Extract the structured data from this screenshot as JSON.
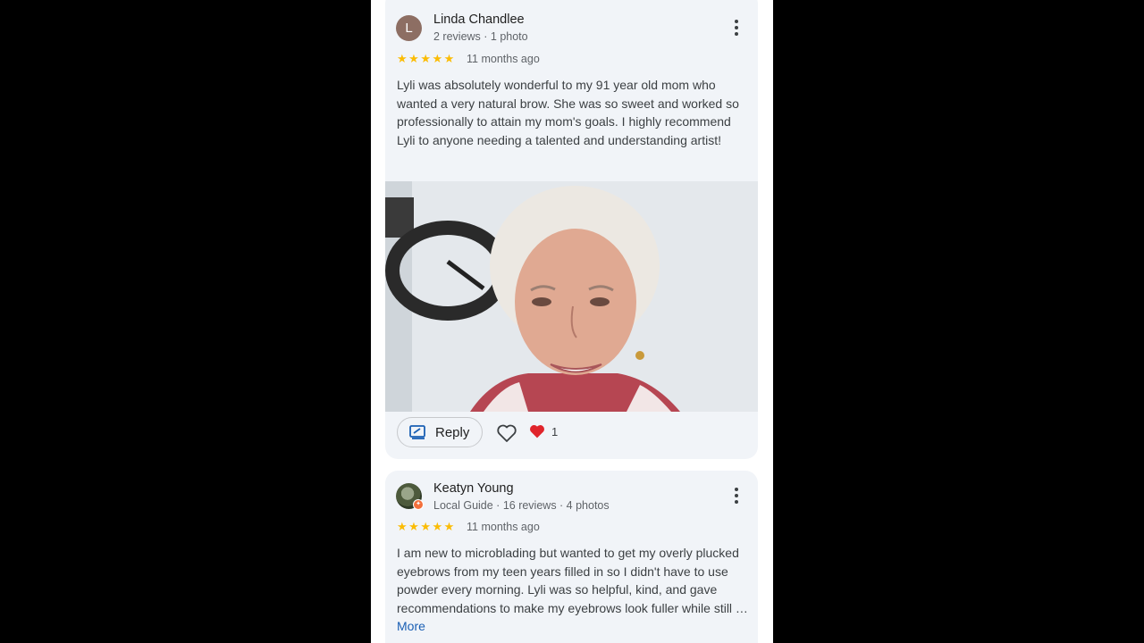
{
  "reviews": [
    {
      "avatar_letter": "L",
      "name": "Linda Chandlee",
      "meta": "2 reviews · 1 photo",
      "rating": 5,
      "when": "11 months ago",
      "text": "Lyli was absolutely wonderful to my 91 year old mom who wanted a very natural brow. She was so sweet and worked so professionally to attain my mom's goals. I highly recommend Lyli to anyone needing a talented and understanding artist!",
      "reply_label": "Reply",
      "reaction_count": "1"
    },
    {
      "name": "Keatyn Young",
      "meta": "Local Guide · 16 reviews · 4 photos",
      "rating": 5,
      "when": "11 months ago",
      "text": "I am new to microblading but wanted to get my overly plucked eyebrows from my teen years filled in so I didn't have to use powder every morning. Lyli was so helpful, kind, and gave recommendations to make my eyebrows look fuller while still …",
      "more_label": "More"
    }
  ],
  "colors": {
    "star": "#fbbc04",
    "link": "#1a5fb4",
    "heart": "#e0242b"
  },
  "icons": [
    "more-vert-icon",
    "star-icon",
    "reply-icon",
    "heart-outline-icon",
    "heart-filled-icon",
    "local-guide-badge-icon"
  ]
}
